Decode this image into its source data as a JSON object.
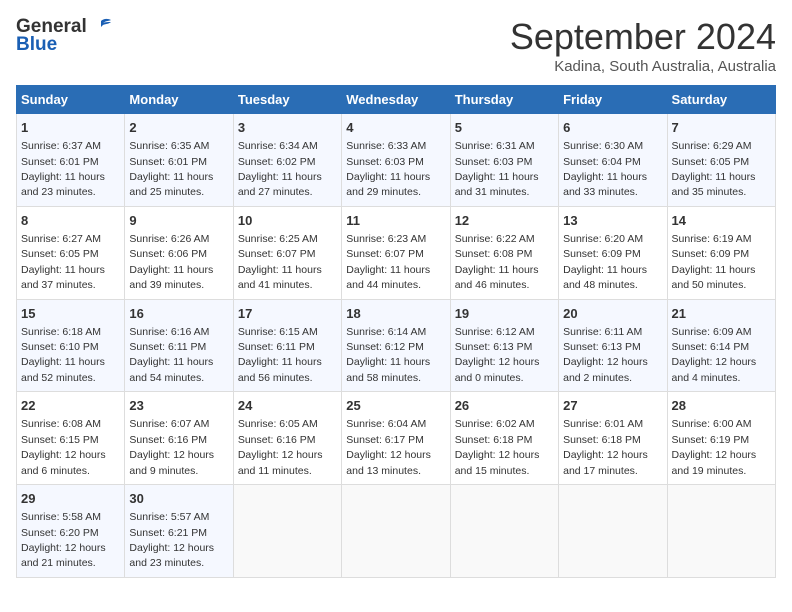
{
  "header": {
    "logo_general": "General",
    "logo_blue": "Blue",
    "month_title": "September 2024",
    "location": "Kadina, South Australia, Australia"
  },
  "days_of_week": [
    "Sunday",
    "Monday",
    "Tuesday",
    "Wednesday",
    "Thursday",
    "Friday",
    "Saturday"
  ],
  "weeks": [
    [
      {
        "day": "1",
        "sunrise": "6:37 AM",
        "sunset": "6:01 PM",
        "daylight": "11 hours and 23 minutes."
      },
      {
        "day": "2",
        "sunrise": "6:35 AM",
        "sunset": "6:01 PM",
        "daylight": "11 hours and 25 minutes."
      },
      {
        "day": "3",
        "sunrise": "6:34 AM",
        "sunset": "6:02 PM",
        "daylight": "11 hours and 27 minutes."
      },
      {
        "day": "4",
        "sunrise": "6:33 AM",
        "sunset": "6:03 PM",
        "daylight": "11 hours and 29 minutes."
      },
      {
        "day": "5",
        "sunrise": "6:31 AM",
        "sunset": "6:03 PM",
        "daylight": "11 hours and 31 minutes."
      },
      {
        "day": "6",
        "sunrise": "6:30 AM",
        "sunset": "6:04 PM",
        "daylight": "11 hours and 33 minutes."
      },
      {
        "day": "7",
        "sunrise": "6:29 AM",
        "sunset": "6:05 PM",
        "daylight": "11 hours and 35 minutes."
      }
    ],
    [
      {
        "day": "8",
        "sunrise": "6:27 AM",
        "sunset": "6:05 PM",
        "daylight": "11 hours and 37 minutes."
      },
      {
        "day": "9",
        "sunrise": "6:26 AM",
        "sunset": "6:06 PM",
        "daylight": "11 hours and 39 minutes."
      },
      {
        "day": "10",
        "sunrise": "6:25 AM",
        "sunset": "6:07 PM",
        "daylight": "11 hours and 41 minutes."
      },
      {
        "day": "11",
        "sunrise": "6:23 AM",
        "sunset": "6:07 PM",
        "daylight": "11 hours and 44 minutes."
      },
      {
        "day": "12",
        "sunrise": "6:22 AM",
        "sunset": "6:08 PM",
        "daylight": "11 hours and 46 minutes."
      },
      {
        "day": "13",
        "sunrise": "6:20 AM",
        "sunset": "6:09 PM",
        "daylight": "11 hours and 48 minutes."
      },
      {
        "day": "14",
        "sunrise": "6:19 AM",
        "sunset": "6:09 PM",
        "daylight": "11 hours and 50 minutes."
      }
    ],
    [
      {
        "day": "15",
        "sunrise": "6:18 AM",
        "sunset": "6:10 PM",
        "daylight": "11 hours and 52 minutes."
      },
      {
        "day": "16",
        "sunrise": "6:16 AM",
        "sunset": "6:11 PM",
        "daylight": "11 hours and 54 minutes."
      },
      {
        "day": "17",
        "sunrise": "6:15 AM",
        "sunset": "6:11 PM",
        "daylight": "11 hours and 56 minutes."
      },
      {
        "day": "18",
        "sunrise": "6:14 AM",
        "sunset": "6:12 PM",
        "daylight": "11 hours and 58 minutes."
      },
      {
        "day": "19",
        "sunrise": "6:12 AM",
        "sunset": "6:13 PM",
        "daylight": "12 hours and 0 minutes."
      },
      {
        "day": "20",
        "sunrise": "6:11 AM",
        "sunset": "6:13 PM",
        "daylight": "12 hours and 2 minutes."
      },
      {
        "day": "21",
        "sunrise": "6:09 AM",
        "sunset": "6:14 PM",
        "daylight": "12 hours and 4 minutes."
      }
    ],
    [
      {
        "day": "22",
        "sunrise": "6:08 AM",
        "sunset": "6:15 PM",
        "daylight": "12 hours and 6 minutes."
      },
      {
        "day": "23",
        "sunrise": "6:07 AM",
        "sunset": "6:16 PM",
        "daylight": "12 hours and 9 minutes."
      },
      {
        "day": "24",
        "sunrise": "6:05 AM",
        "sunset": "6:16 PM",
        "daylight": "12 hours and 11 minutes."
      },
      {
        "day": "25",
        "sunrise": "6:04 AM",
        "sunset": "6:17 PM",
        "daylight": "12 hours and 13 minutes."
      },
      {
        "day": "26",
        "sunrise": "6:02 AM",
        "sunset": "6:18 PM",
        "daylight": "12 hours and 15 minutes."
      },
      {
        "day": "27",
        "sunrise": "6:01 AM",
        "sunset": "6:18 PM",
        "daylight": "12 hours and 17 minutes."
      },
      {
        "day": "28",
        "sunrise": "6:00 AM",
        "sunset": "6:19 PM",
        "daylight": "12 hours and 19 minutes."
      }
    ],
    [
      {
        "day": "29",
        "sunrise": "5:58 AM",
        "sunset": "6:20 PM",
        "daylight": "12 hours and 21 minutes."
      },
      {
        "day": "30",
        "sunrise": "5:57 AM",
        "sunset": "6:21 PM",
        "daylight": "12 hours and 23 minutes."
      },
      null,
      null,
      null,
      null,
      null
    ]
  ],
  "labels": {
    "sunrise": "Sunrise:",
    "sunset": "Sunset:",
    "daylight": "Daylight:"
  }
}
